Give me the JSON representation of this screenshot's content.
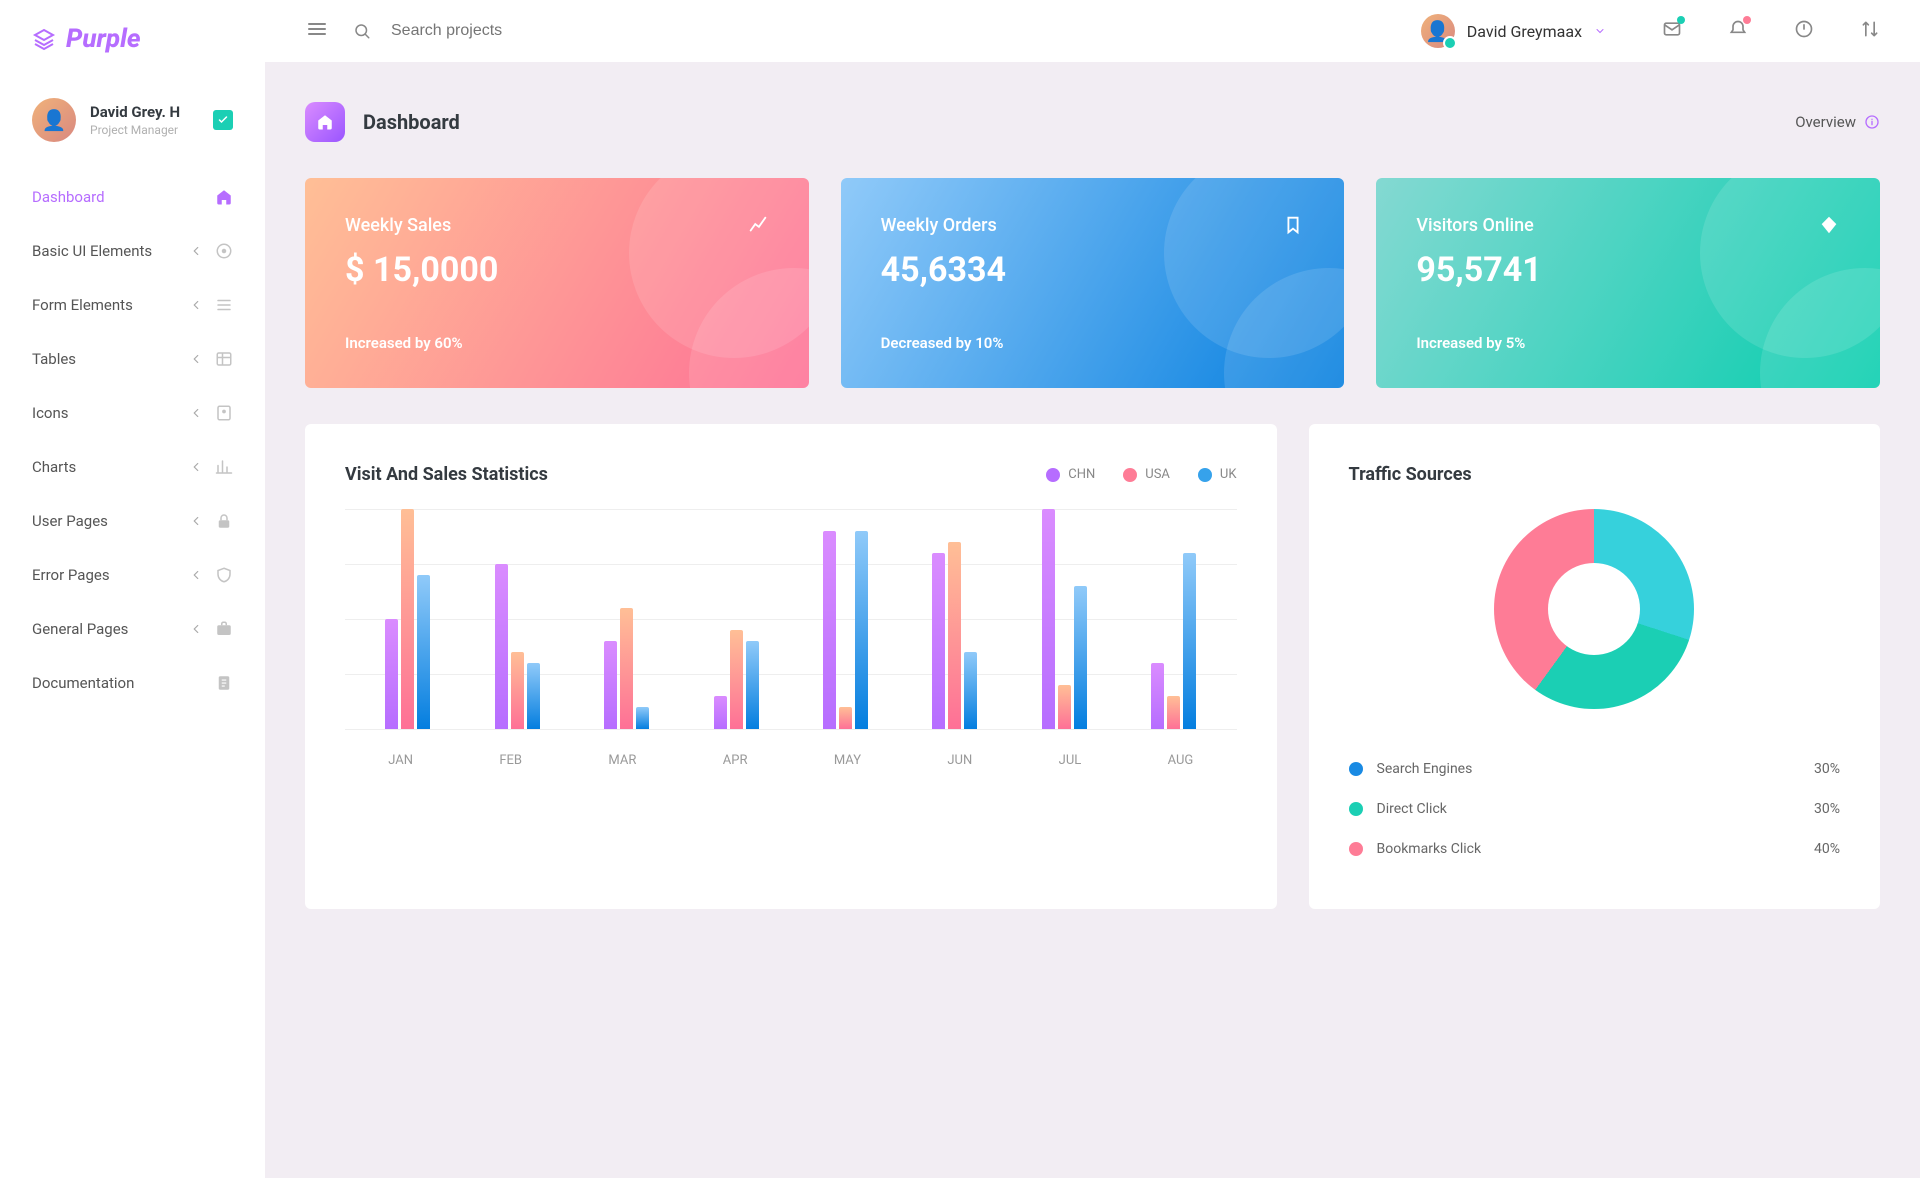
{
  "brand": "Purple",
  "sidebar": {
    "profile": {
      "name": "David Grey. H",
      "role": "Project Manager"
    },
    "items": [
      {
        "label": "Dashboard",
        "icon": "home",
        "expandable": false,
        "active": true
      },
      {
        "label": "Basic UI Elements",
        "icon": "target",
        "expandable": true
      },
      {
        "label": "Form Elements",
        "icon": "list",
        "expandable": true
      },
      {
        "label": "Tables",
        "icon": "table",
        "expandable": true
      },
      {
        "label": "Icons",
        "icon": "contacts",
        "expandable": true
      },
      {
        "label": "Charts",
        "icon": "bar-chart",
        "expandable": true
      },
      {
        "label": "User Pages",
        "icon": "lock",
        "expandable": true
      },
      {
        "label": "Error Pages",
        "icon": "shield",
        "expandable": true
      },
      {
        "label": "General Pages",
        "icon": "briefcase",
        "expandable": true
      },
      {
        "label": "Documentation",
        "icon": "document",
        "expandable": false
      }
    ]
  },
  "topbar": {
    "search_placeholder": "Search projects",
    "user_name": "David Greymaax"
  },
  "page": {
    "title": "Dashboard",
    "overview_label": "Overview"
  },
  "cards": [
    {
      "label": "Weekly Sales",
      "value": "$ 15,0000",
      "delta": "Increased by 60%",
      "icon": "chart-line",
      "class": "card-pink"
    },
    {
      "label": "Weekly Orders",
      "value": "45,6334",
      "delta": "Decreased by 10%",
      "icon": "bookmark",
      "class": "card-blue"
    },
    {
      "label": "Visitors Online",
      "value": "95,5741",
      "delta": "Increased by 5%",
      "icon": "diamond",
      "class": "card-green"
    }
  ],
  "barchart": {
    "title": "Visit And Sales Statistics",
    "legend": [
      {
        "label": "CHN",
        "color": "#b66dff"
      },
      {
        "label": "USA",
        "color": "#fe7c96"
      },
      {
        "label": "UK",
        "color": "#36a2eb"
      }
    ]
  },
  "traffic": {
    "title": "Traffic Sources",
    "items": [
      {
        "label": "Search Engines",
        "value": "30%",
        "color": "#198ae3"
      },
      {
        "label": "Direct Click",
        "value": "30%",
        "color": "#1bcfb4"
      },
      {
        "label": "Bookmarks Click",
        "value": "40%",
        "color": "#fe7c96"
      }
    ]
  },
  "chart_data": [
    {
      "type": "bar",
      "title": "Visit And Sales Statistics",
      "categories": [
        "JAN",
        "FEB",
        "MAR",
        "APR",
        "MAY",
        "JUN",
        "JUL",
        "AUG"
      ],
      "series": [
        {
          "name": "CHN",
          "values": [
            50,
            75,
            40,
            15,
            90,
            80,
            100,
            30
          ]
        },
        {
          "name": "USA",
          "values": [
            100,
            35,
            55,
            45,
            10,
            85,
            20,
            15
          ]
        },
        {
          "name": "UK",
          "values": [
            70,
            30,
            10,
            40,
            90,
            35,
            65,
            80
          ]
        }
      ],
      "ylim": [
        0,
        100
      ]
    },
    {
      "type": "pie",
      "title": "Traffic Sources",
      "categories": [
        "Search Engines",
        "Direct Click",
        "Bookmarks Click"
      ],
      "values": [
        30,
        30,
        40
      ]
    }
  ],
  "colors": {
    "purple": "#b66dff",
    "pink": "#fe7c96",
    "blue": "#36a2eb",
    "teal": "#1bcfb4"
  }
}
